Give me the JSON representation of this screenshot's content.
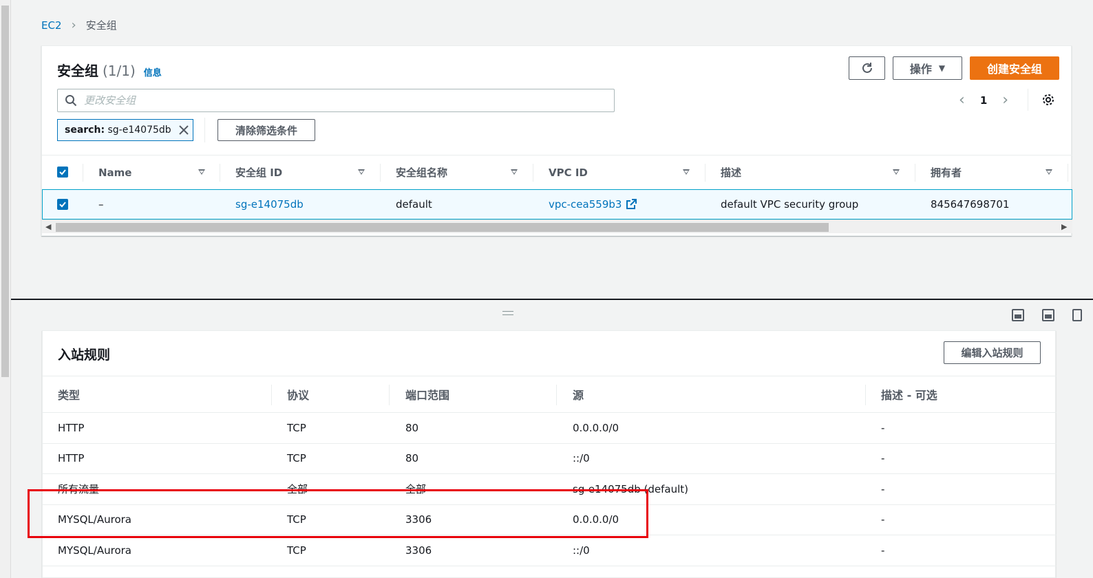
{
  "breadcrumb": {
    "root": "EC2",
    "current": "安全组"
  },
  "security_groups": {
    "title": "安全组",
    "count": "(1/1)",
    "info_link": "信息",
    "actions_label": "操作",
    "create_label": "创建安全组",
    "search_placeholder": "更改安全组",
    "filter_token_key": "search:",
    "filter_token_value": "sg-e14075db",
    "clear_filters_label": "清除筛选条件",
    "page_number": "1",
    "columns": [
      "Name",
      "安全组 ID",
      "安全组名称",
      "VPC ID",
      "描述",
      "拥有者"
    ],
    "rows": [
      {
        "name": "–",
        "sg_id": "sg-e14075db",
        "sg_name": "default",
        "vpc_id": "vpc-cea559b3",
        "description": "default VPC security group",
        "owner": "845647698701"
      }
    ]
  },
  "inbound_rules": {
    "title": "入站规则",
    "edit_label": "编辑入站规则",
    "columns": [
      "类型",
      "协议",
      "端口范围",
      "源",
      "描述 - 可选"
    ],
    "rows": [
      {
        "type": "HTTP",
        "protocol": "TCP",
        "port": "80",
        "source": "0.0.0.0/0",
        "description": "-"
      },
      {
        "type": "HTTP",
        "protocol": "TCP",
        "port": "80",
        "source": "::/0",
        "description": "-"
      },
      {
        "type": "所有流量",
        "protocol": "全部",
        "port": "全部",
        "source": "sg-e14075db (default)",
        "description": "-"
      },
      {
        "type": "MYSQL/Aurora",
        "protocol": "TCP",
        "port": "3306",
        "source": "0.0.0.0/0",
        "description": "-"
      },
      {
        "type": "MYSQL/Aurora",
        "protocol": "TCP",
        "port": "3306",
        "source": "::/0",
        "description": "-"
      }
    ]
  },
  "colors": {
    "link": "#0073bb",
    "primary_button": "#ec7211",
    "highlight": "#e8000b",
    "selected_row_bg": "#f1faff"
  }
}
